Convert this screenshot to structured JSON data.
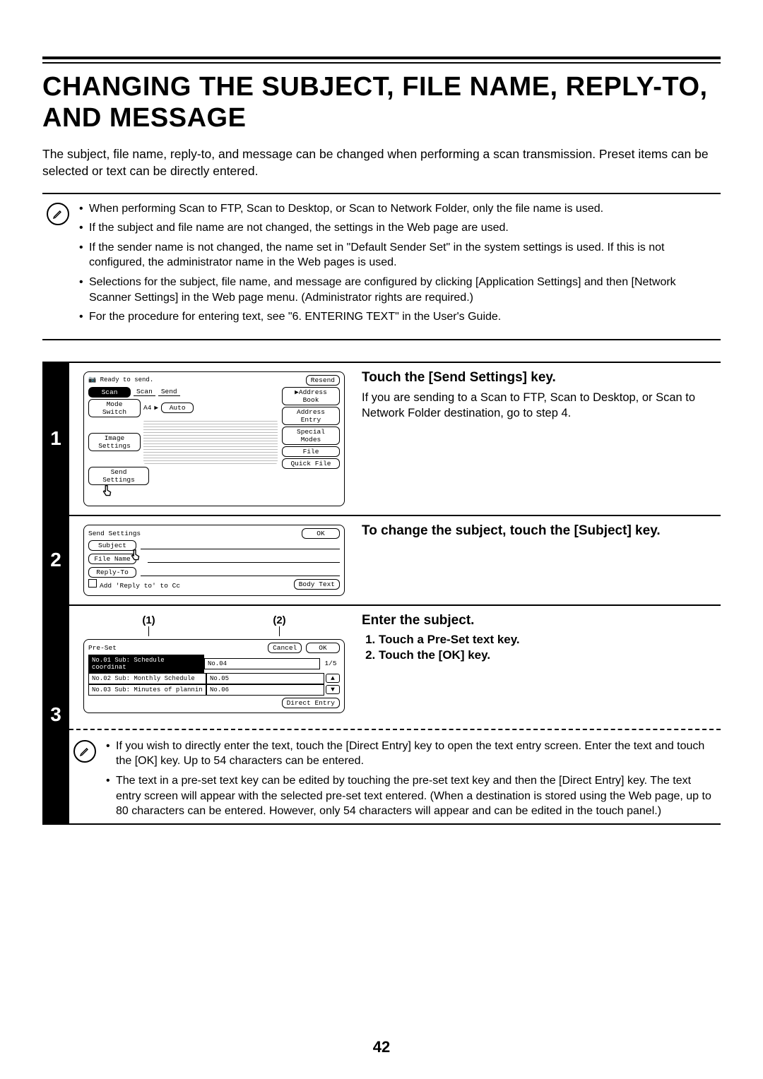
{
  "page": {
    "number": "42",
    "title": "CHANGING THE SUBJECT, FILE NAME, REPLY-TO, AND MESSAGE",
    "intro": "The subject, file name, reply-to, and message can be changed when performing a scan transmission. Preset items can be selected or text can be directly entered."
  },
  "info_notes": [
    "When performing Scan to FTP, Scan to Desktop, or Scan to Network Folder, only the file name is used.",
    "If the subject and file name are not changed, the settings in the Web page are used.",
    "If the sender name is not changed, the name set in \"Default Sender Set\" in the system settings is used. If this is not configured, the administrator name in the Web pages is used.",
    "Selections for the subject, file name, and message are configured by clicking [Application Settings] and then [Network Scanner Settings] in the Web page menu. (Administrator rights are required.)",
    "For the procedure for entering text, see \"6. ENTERING TEXT\" in the User's Guide."
  ],
  "step1": {
    "number": "1",
    "heading": "Touch the [Send Settings] key.",
    "text": "If you are sending to a Scan to FTP, Scan to Desktop, or Scan to Network Folder destination, go to step 4.",
    "panel": {
      "status": "Ready to send.",
      "resend": "Resend",
      "tabs": {
        "scan": "Scan",
        "send": "Send"
      },
      "mode_switch": "Mode Switch",
      "paper": "A4",
      "auto": "Auto",
      "image_settings": "Image Settings",
      "send_settings": "Send Settings",
      "side_buttons": [
        "Address Book",
        "Address Entry",
        "Special Modes",
        "File",
        "Quick File"
      ]
    }
  },
  "step2": {
    "number": "2",
    "heading": "To change the subject, touch the [Subject] key.",
    "panel": {
      "title": "Send Settings",
      "ok": "OK",
      "fields": {
        "subject": "Subject",
        "file_name": "File Name",
        "reply_to": "Reply-To"
      },
      "cc_label": "Add 'Reply to' to Cc",
      "body_text": "Body Text"
    }
  },
  "step3": {
    "number": "3",
    "heading": "Enter the subject.",
    "instructions": [
      "Touch a Pre-Set text key.",
      "Touch the [OK] key."
    ],
    "annotations": {
      "a1": "(1)",
      "a2": "(2)"
    },
    "panel": {
      "title": "Pre-Set",
      "cancel": "Cancel",
      "ok": "OK",
      "page": "1/5",
      "rows": [
        {
          "left": "No.01 Sub: Schedule coordinat",
          "right": "No.04"
        },
        {
          "left": "No.02 Sub: Monthly Schedule",
          "right": "No.05"
        },
        {
          "left": "No.03 Sub: Minutes of plannin",
          "right": "No.06"
        }
      ],
      "direct_entry": "Direct Entry"
    },
    "notes": [
      "If you wish to directly enter the text, touch the [Direct Entry] key to open the text entry screen. Enter the text and touch the [OK] key. Up to 54 characters can be entered.",
      "The text in a pre-set text key can be edited by touching the pre-set text key and then the [Direct Entry] key. The text entry screen will appear with the selected pre-set text entered. (When a destination is stored using the Web page, up to 80 characters can be entered. However, only 54 characters will appear and can be edited in the touch panel.)"
    ]
  }
}
